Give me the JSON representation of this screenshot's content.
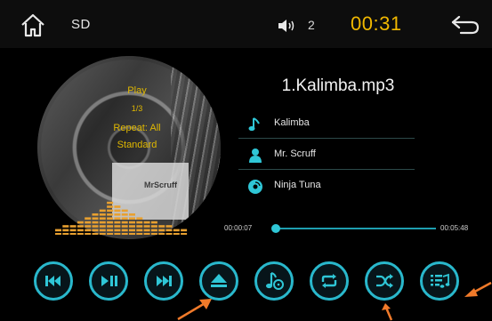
{
  "header": {
    "source_label": "SD",
    "volume_level": "2",
    "clock": "00:31",
    "home_icon": "home-icon",
    "volume_icon": "speaker-icon",
    "back_icon": "back-arrow-icon"
  },
  "disc": {
    "play_status": "Play",
    "track_position": "1/3",
    "repeat_mode": "Repeat: All",
    "eq_mode": "Standard"
  },
  "track": {
    "file_name": "1.Kalimba.mp3",
    "title": "Kalimba",
    "artist": "Mr. Scruff",
    "album": "Ninja Tuna"
  },
  "progress": {
    "elapsed": "00:00:07",
    "total": "00:05:48",
    "fraction": 0.02
  },
  "controls": [
    {
      "name": "previous-button",
      "icon": "skip-back-icon"
    },
    {
      "name": "play-pause-button",
      "icon": "play-pause-icon"
    },
    {
      "name": "next-button",
      "icon": "skip-forward-icon"
    },
    {
      "name": "eject-button",
      "icon": "eject-icon"
    },
    {
      "name": "music-source-button",
      "icon": "music-note-disc-icon"
    },
    {
      "name": "repeat-button",
      "icon": "repeat-icon"
    },
    {
      "name": "shuffle-button",
      "icon": "shuffle-icon"
    },
    {
      "name": "playlist-button",
      "icon": "playlist-icon"
    }
  ],
  "colors": {
    "accent": "#29b8cc",
    "clock": "#f1b800",
    "disc_text": "#e0b800",
    "eq_bars": "#e8a030",
    "annotation_arrow": "#f07a2a"
  }
}
